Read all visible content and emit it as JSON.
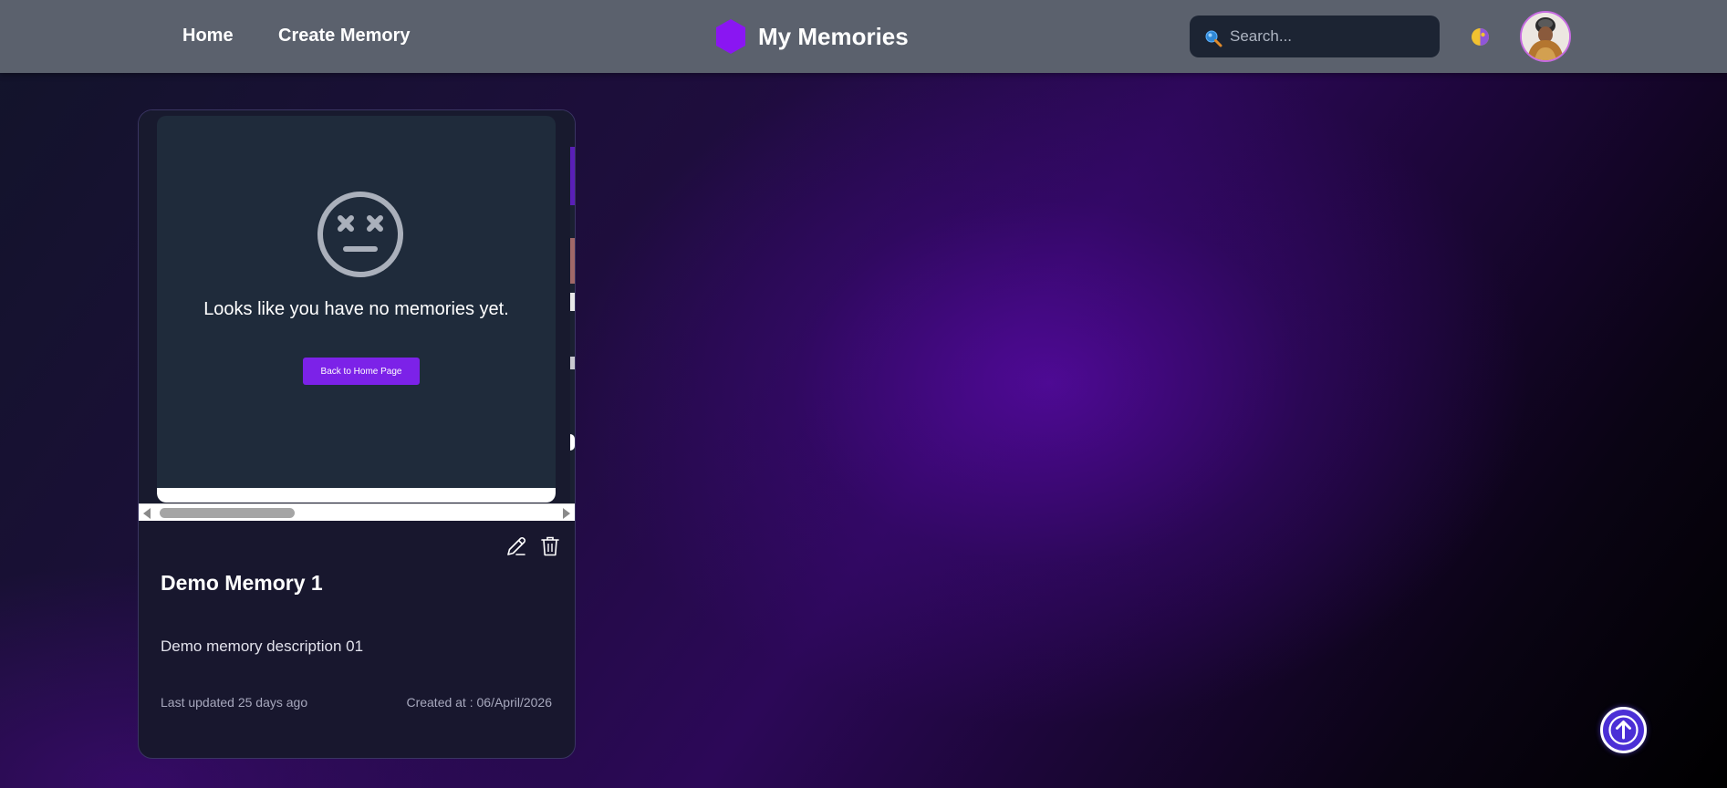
{
  "navbar": {
    "links": [
      {
        "label": "Home"
      },
      {
        "label": "Create Memory"
      }
    ],
    "brand": {
      "title": "My Memories",
      "logo_icon": "hexagon-logo-icon",
      "logo_color": "#8a16f2"
    },
    "search": {
      "placeholder": "Search...",
      "value": "",
      "icon": "search-icon"
    },
    "theme_toggle_icon": "theme-toggle-icon",
    "avatar_icon": "avatar"
  },
  "card": {
    "preview": {
      "face_icon": "dizzy-face-icon",
      "empty_message": "Looks like you have no memories yet.",
      "button_label": "Back to Home Page"
    },
    "actions": {
      "edit_icon": "edit-icon",
      "delete_icon": "trash-icon"
    },
    "title": "Demo Memory 1",
    "description": "Demo memory description 01",
    "last_updated": "Last updated 25 days ago",
    "created_at": "Created at : 06/April/2026"
  },
  "scroll_to_top_icon": "arrow-up-icon",
  "colors": {
    "navbar": "#5b616d",
    "accent": "#7c22e8",
    "card_bg": "#18172e",
    "scroll_top_button": "#4b2fd6"
  }
}
